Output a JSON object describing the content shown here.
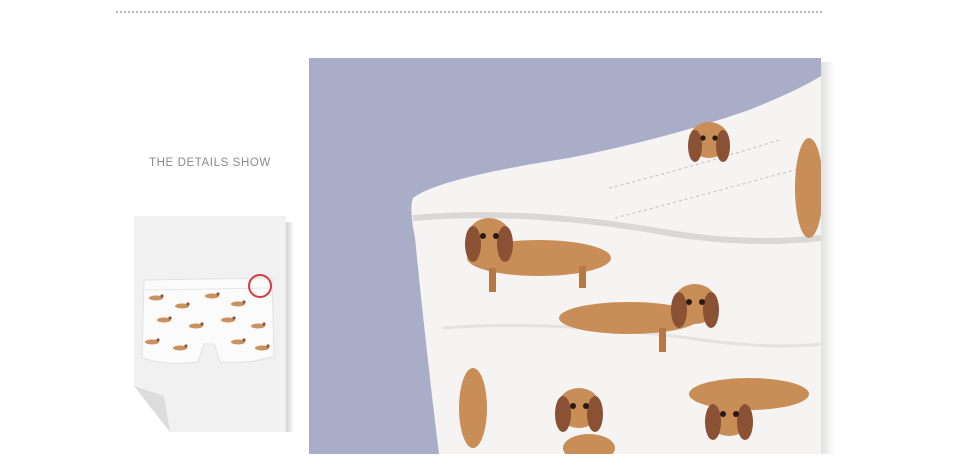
{
  "section": {
    "title": "THE DETAILS SHOW"
  },
  "thumbnail": {
    "alt": "dachshund print shorts",
    "highlight_color": "#d63a3a"
  },
  "detail_photo": {
    "alt": "close-up of waistband with dachshund print",
    "background_color": "#a9adc8",
    "fabric_color": "#f5f4f2"
  }
}
